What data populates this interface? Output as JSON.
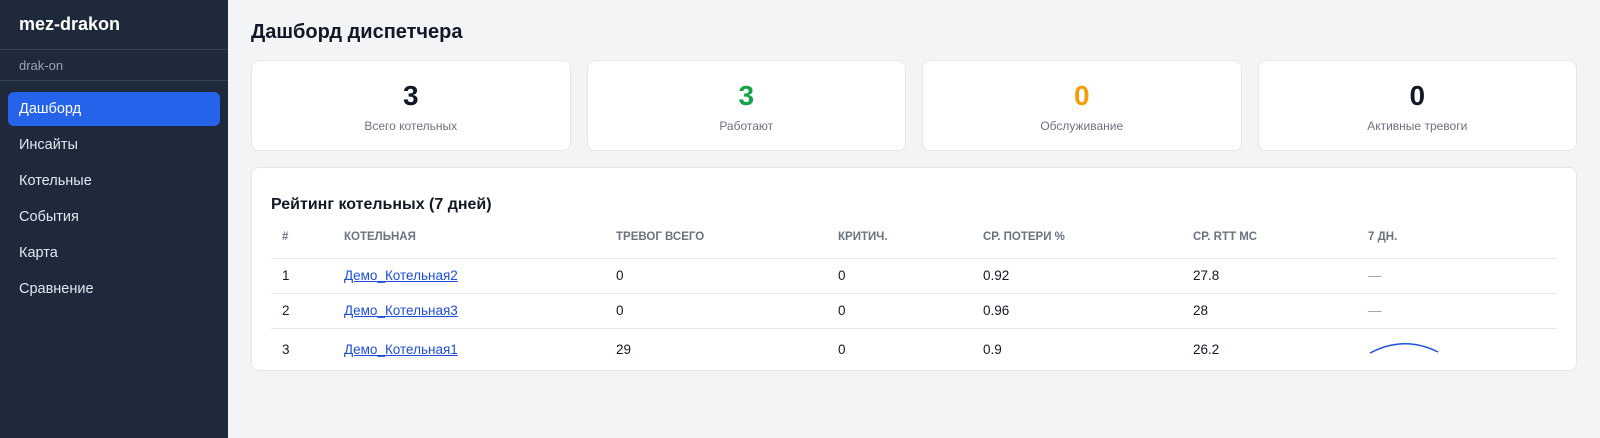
{
  "app": {
    "name": "mez-drakon",
    "subtitle": "drak-on"
  },
  "nav": [
    {
      "label": "Дашборд",
      "active": true
    },
    {
      "label": "Инсайты"
    },
    {
      "label": "Котельные"
    },
    {
      "label": "События"
    },
    {
      "label": "Карта"
    },
    {
      "label": "Сравнение"
    }
  ],
  "page": {
    "title": "Дашборд диспетчера"
  },
  "stats": [
    {
      "value": "3",
      "label": "Всего котельных",
      "color": "#111827"
    },
    {
      "value": "3",
      "label": "Работают",
      "color": "#16a34a"
    },
    {
      "value": "0",
      "label": "Обслуживание",
      "color": "#f59e0b"
    },
    {
      "value": "0",
      "label": "Активные тревоги",
      "color": "#111827"
    }
  ],
  "ranking": {
    "title": "Рейтинг котельных (7 дней)",
    "columns": [
      "#",
      "Котельная",
      "Тревог всего",
      "Критич.",
      "Ср. потери %",
      "Ср. RTT мс",
      "7 дн."
    ],
    "rows": [
      {
        "rank": "1",
        "name": "Демо_Котельная2",
        "alarms": "0",
        "critical": "0",
        "loss": "0.92",
        "rtt": "27.8",
        "trend": "—"
      },
      {
        "rank": "2",
        "name": "Демо_Котельная3",
        "alarms": "0",
        "critical": "0",
        "loss": "0.96",
        "rtt": "28",
        "trend": "—"
      },
      {
        "rank": "3",
        "name": "Демо_Котельная1",
        "alarms": "29",
        "critical": "0",
        "loss": "0.9",
        "rtt": "26.2",
        "trend": "sparkline"
      }
    ]
  }
}
